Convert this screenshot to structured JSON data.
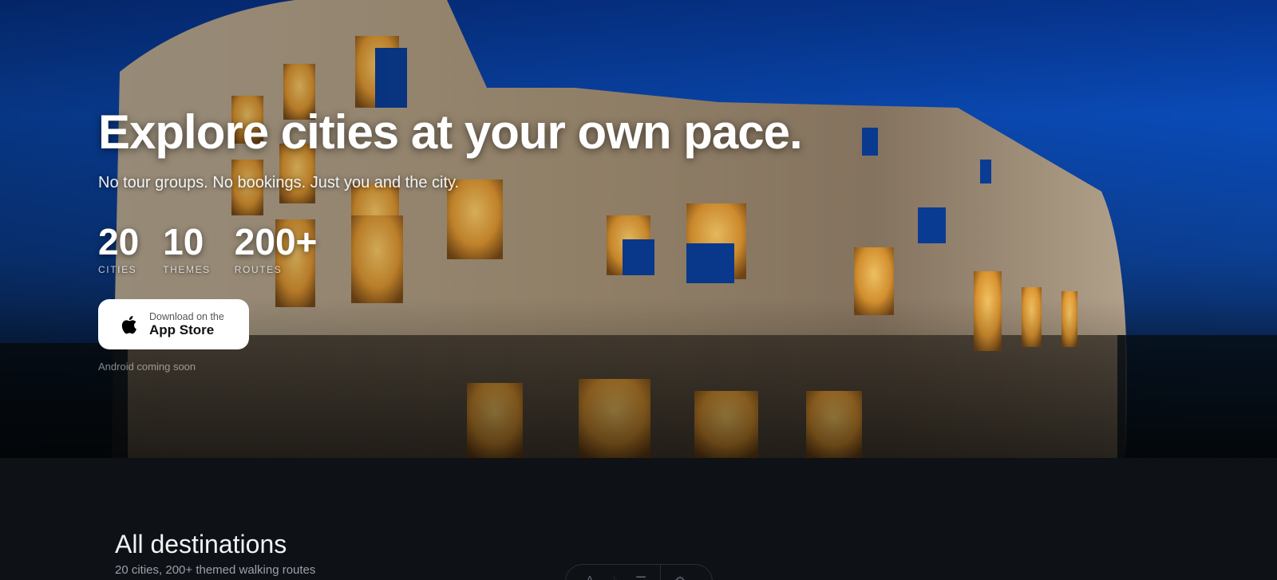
{
  "hero": {
    "title": "Explore cities at your own pace.",
    "subtitle": "No tour groups. No bookings. Just you and the city.",
    "stats": [
      {
        "value": "20",
        "label": "CITIES"
      },
      {
        "value": "10",
        "label": "THEMES"
      },
      {
        "value": "200+",
        "label": "ROUTES"
      }
    ],
    "appstore": {
      "small": "Download on the",
      "big": "App Store",
      "icon": "apple-icon"
    },
    "android_note": "Android coming soon",
    "background_image": "colosseum-night"
  },
  "destinations": {
    "title": "All destinations",
    "subtitle": "20 cities, 200+ themed walking routes"
  },
  "filter_bar": {
    "icons": [
      "text-icon",
      "food-icon",
      "list-icon",
      "settings-icon"
    ]
  },
  "colors": {
    "page_background": "#0e1116",
    "sky": "#0a4bb8",
    "button_background": "#ffffff"
  }
}
